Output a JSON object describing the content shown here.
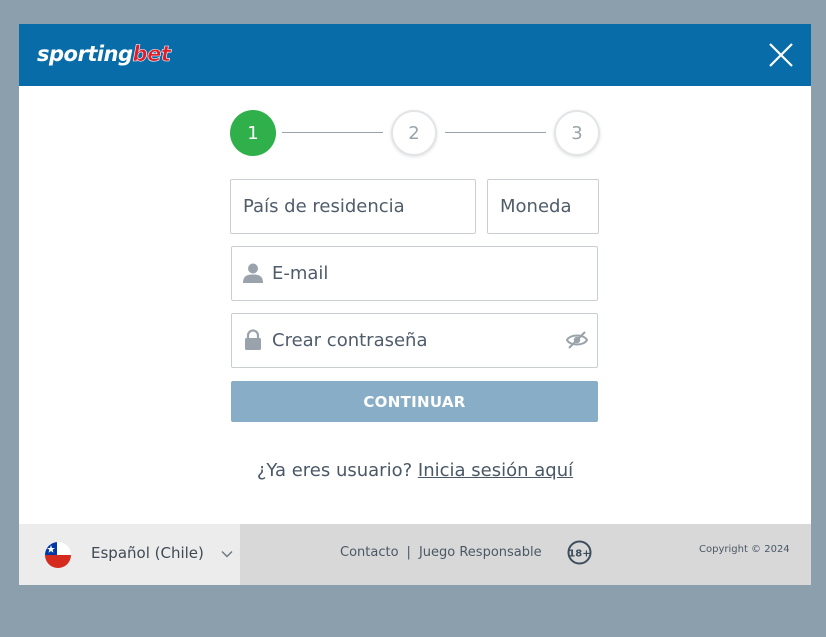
{
  "brand": {
    "logo_part1": "sporting",
    "logo_part2": "bet",
    "header_color": "#076ca8",
    "accent_red": "#e01e2a"
  },
  "stepper": {
    "steps": [
      {
        "label": "1",
        "state": "active"
      },
      {
        "label": "2",
        "state": "inactive"
      },
      {
        "label": "3",
        "state": "inactive"
      }
    ],
    "active_color": "#2fb04a"
  },
  "form": {
    "country_placeholder": "País de residencia",
    "currency_placeholder": "Moneda",
    "email_placeholder": "E-mail",
    "password_placeholder": "Crear contraseña",
    "email_icon": "user-icon",
    "password_icon": "lock-icon",
    "visibility_icon": "eye-off-icon",
    "continue_label": "CONTINUAR",
    "continue_color": "#88aec7"
  },
  "login_prompt": {
    "text": "¿Ya eres usuario?",
    "link": "Inicia sesión aquí"
  },
  "footer": {
    "language": "Español (Chile)",
    "flag_icon": "chile-flag-icon",
    "links": [
      "Contacto",
      "Juego Responsable"
    ],
    "separator": "|",
    "age_badge": "18+",
    "copyright": "Copyright © 2024"
  }
}
